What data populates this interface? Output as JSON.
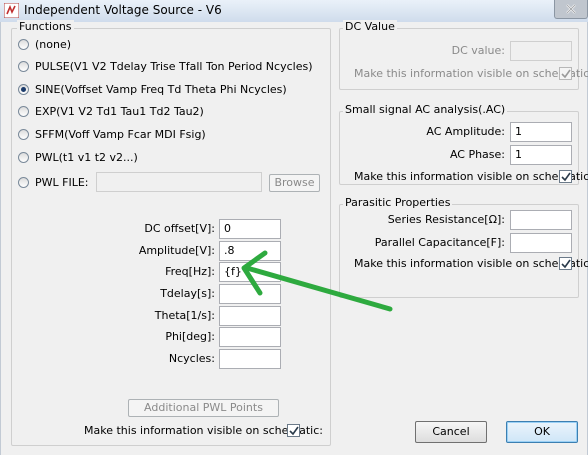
{
  "window": {
    "title": "Independent Voltage Source - V6"
  },
  "functions": {
    "title": "Functions",
    "options": [
      {
        "label": "(none)",
        "selected": false
      },
      {
        "label": "PULSE(V1 V2 Tdelay Trise Tfall Ton Period Ncycles)",
        "selected": false
      },
      {
        "label": "SINE(Voffset Vamp Freq Td Theta Phi Ncycles)",
        "selected": true
      },
      {
        "label": "EXP(V1 V2 Td1 Tau1 Td2 Tau2)",
        "selected": false
      },
      {
        "label": "SFFM(Voff Vamp Fcar MDI Fsig)",
        "selected": false
      },
      {
        "label": "PWL(t1 v1 t2 v2...)",
        "selected": false
      },
      {
        "label": "PWL FILE:",
        "selected": false
      }
    ],
    "pwl_file_value": "",
    "browse_label": "Browse",
    "params": [
      {
        "label": "DC offset[V]:",
        "value": "0"
      },
      {
        "label": "Amplitude[V]:",
        "value": ".8"
      },
      {
        "label": "Freq[Hz]:",
        "value": "{f}"
      },
      {
        "label": "Tdelay[s]:",
        "value": ""
      },
      {
        "label": "Theta[1/s]:",
        "value": ""
      },
      {
        "label": "Phi[deg]:",
        "value": ""
      },
      {
        "label": "Ncycles:",
        "value": ""
      }
    ],
    "additional_pwl_label": "Additional PWL Points",
    "visible_label": "Make this information visible on schematic:",
    "visible_checked": true
  },
  "dc_value": {
    "title": "DC Value",
    "label": "DC value:",
    "value": "",
    "visible_label": "Make this information visible on schematic:",
    "visible_checked": true
  },
  "ac": {
    "title": "Small signal AC analysis(.AC)",
    "amplitude_label": "AC Amplitude:",
    "amplitude_value": "1",
    "phase_label": "AC Phase:",
    "phase_value": "1",
    "visible_label": "Make this information visible on schematic:",
    "visible_checked": true
  },
  "parasitic": {
    "title": "Parasitic Properties",
    "series_label": "Series Resistance[Ω]:",
    "series_value": "",
    "parallel_label": "Parallel Capacitance[F]:",
    "parallel_value": "",
    "visible_label": "Make this information visible on schematic:",
    "visible_checked": true
  },
  "buttons": {
    "cancel": "Cancel",
    "ok": "OK"
  },
  "annotation": {
    "arrow_color": "#2eaa3f"
  }
}
